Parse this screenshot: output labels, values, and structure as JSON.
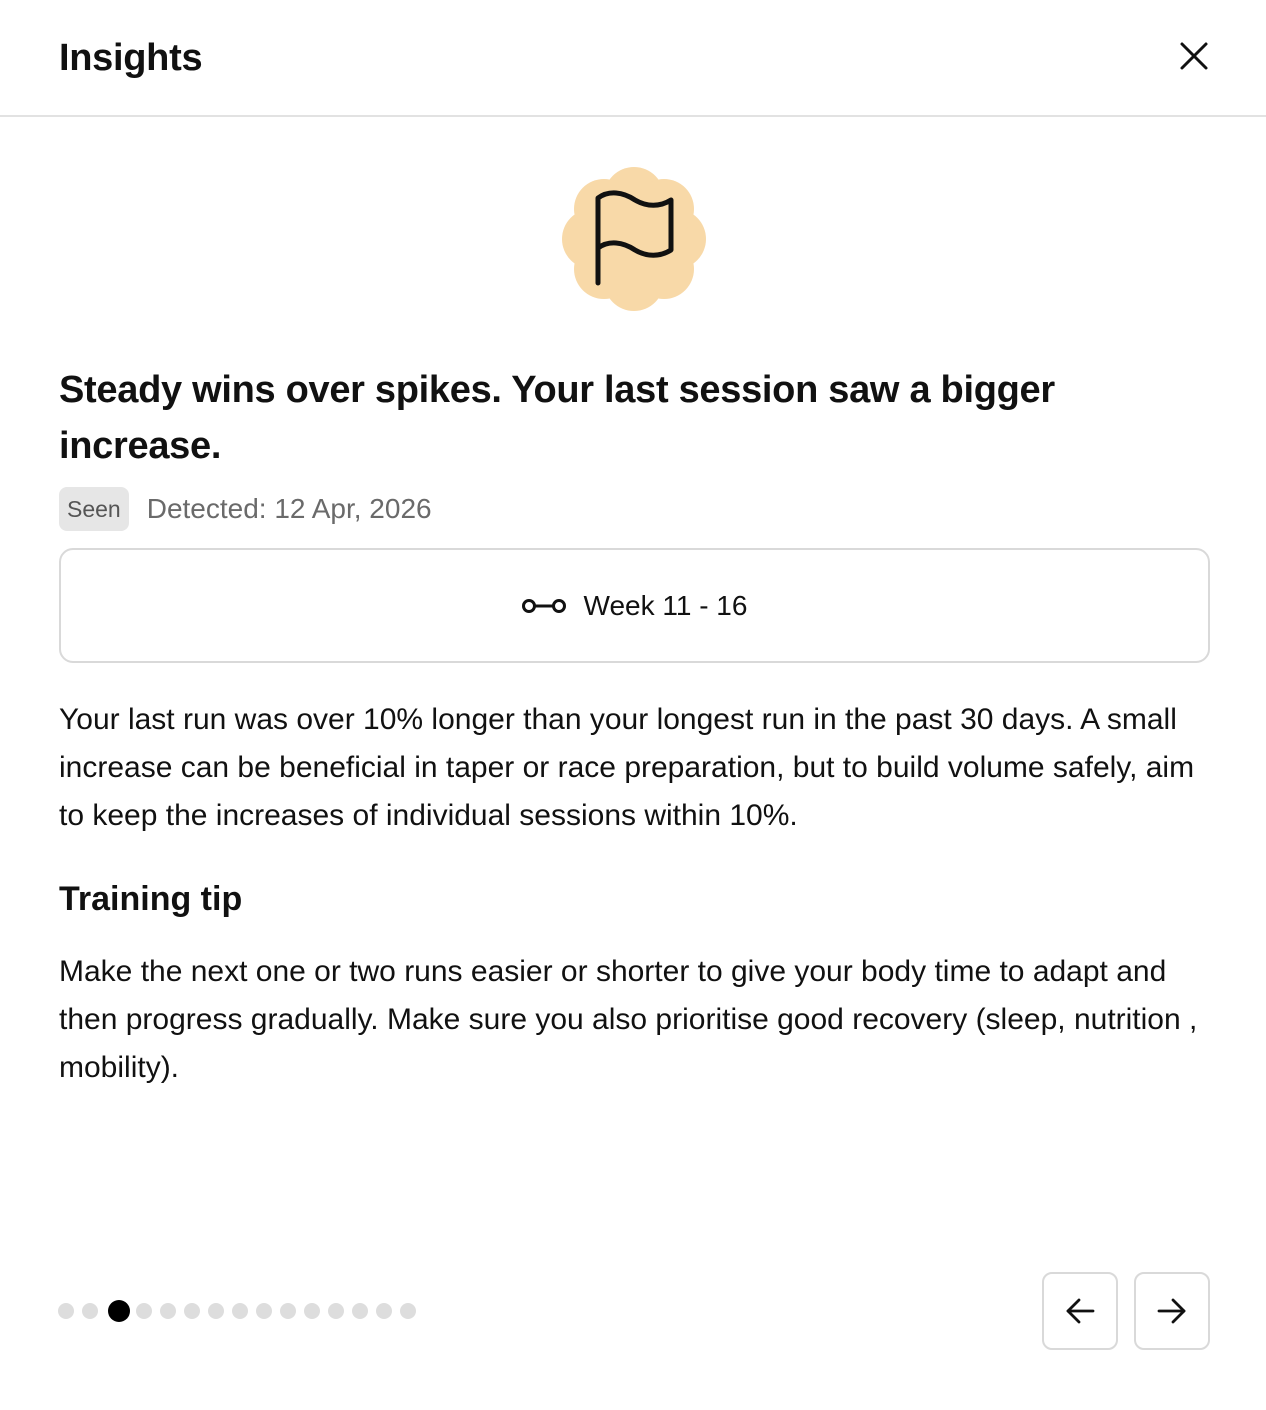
{
  "header": {
    "title": "Insights"
  },
  "insight": {
    "icon": "flag-icon",
    "icon_background": "#f8d9a8",
    "headline": "Steady wins over spikes. Your last session saw a bigger increase.",
    "status_badge": "Seen",
    "detected": "Detected: 12 Apr, 2026",
    "week_range": {
      "icon": "range-icon",
      "label": "Week 11 - 16"
    },
    "description": "Your last run was over 10% longer than your longest run in the past 30 days. A small increase can be beneficial in taper or race preparation, but to build volume safely, aim to keep the increases of individual sessions within 10%.",
    "tip_title": "Training tip",
    "tip_text": "Make the next one or two runs easier or shorter to give your body time to adapt and then progress gradually. Make sure you also prioritise good recovery (sleep, nutrition , mobility)."
  },
  "pagination": {
    "total": 15,
    "current": 3,
    "active_color": "#000000",
    "inactive_color": "#dddddd"
  },
  "navigation": {
    "prev_icon": "arrow-left-icon",
    "next_icon": "arrow-right-icon"
  }
}
